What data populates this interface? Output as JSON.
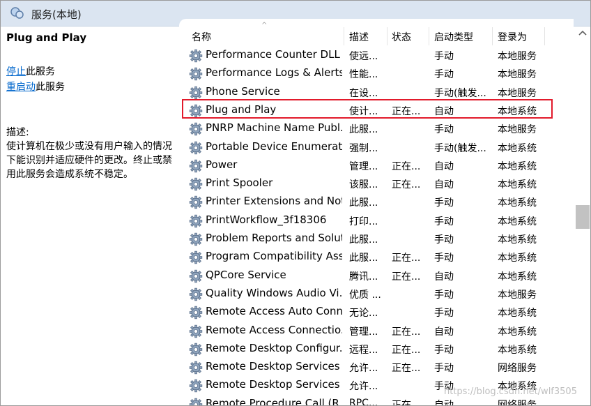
{
  "window": {
    "title": "服务(本地)"
  },
  "left_pane": {
    "service_title": "Plug and Play",
    "actions": [
      {
        "link": "停止",
        "text": "此服务"
      },
      {
        "link": "重启动",
        "text": "此服务"
      }
    ],
    "description_label": "描述:",
    "description": "使计算机在极少或没有用户输入的情况下能识别并适应硬件的更改。终止或禁用此服务会造成系统不稳定。"
  },
  "columns": {
    "name": "名称",
    "description": "描述",
    "status": "状态",
    "startup": "启动类型",
    "logon": "登录为"
  },
  "rows": [
    {
      "name": "Performance Counter DLL ...",
      "desc": "使远...",
      "status": "",
      "startup": "手动",
      "logon": "本地服务"
    },
    {
      "name": "Performance Logs & Alerts",
      "desc": "性能...",
      "status": "",
      "startup": "手动",
      "logon": "本地服务"
    },
    {
      "name": "Phone Service",
      "desc": "在设...",
      "status": "",
      "startup": "手动(触发...",
      "logon": "本地服务"
    },
    {
      "name": "Plug and Play",
      "desc": "使计...",
      "status": "正在...",
      "startup": "自动",
      "logon": "本地系统"
    },
    {
      "name": "PNRP Machine Name Publ...",
      "desc": "此服...",
      "status": "",
      "startup": "手动",
      "logon": "本地服务"
    },
    {
      "name": "Portable Device Enumerat...",
      "desc": "强制...",
      "status": "",
      "startup": "手动(触发...",
      "logon": "本地系统"
    },
    {
      "name": "Power",
      "desc": "管理...",
      "status": "正在...",
      "startup": "自动",
      "logon": "本地系统"
    },
    {
      "name": "Print Spooler",
      "desc": "该服...",
      "status": "正在...",
      "startup": "自动",
      "logon": "本地系统"
    },
    {
      "name": "Printer Extensions and Noti...",
      "desc": "此服...",
      "status": "",
      "startup": "手动",
      "logon": "本地系统"
    },
    {
      "name": "PrintWorkflow_3f18306",
      "desc": "打印...",
      "status": "",
      "startup": "手动",
      "logon": "本地系统"
    },
    {
      "name": "Problem Reports and Solut...",
      "desc": "此服...",
      "status": "",
      "startup": "手动",
      "logon": "本地系统"
    },
    {
      "name": "Program Compatibility Assi...",
      "desc": "此服...",
      "status": "正在...",
      "startup": "手动",
      "logon": "本地系统"
    },
    {
      "name": "QPCore Service",
      "desc": "腾讯...",
      "status": "正在...",
      "startup": "自动",
      "logon": "本地系统"
    },
    {
      "name": "Quality Windows Audio Vi...",
      "desc": "优质 ...",
      "status": "",
      "startup": "手动",
      "logon": "本地服务"
    },
    {
      "name": "Remote Access Auto Conn...",
      "desc": "无论...",
      "status": "",
      "startup": "手动",
      "logon": "本地系统"
    },
    {
      "name": "Remote Access Connectio...",
      "desc": "管理...",
      "status": "正在...",
      "startup": "自动",
      "logon": "本地系统"
    },
    {
      "name": "Remote Desktop Configur...",
      "desc": "远程...",
      "status": "正在...",
      "startup": "手动",
      "logon": "本地系统"
    },
    {
      "name": "Remote Desktop Services",
      "desc": "允许...",
      "status": "正在...",
      "startup": "手动",
      "logon": "网络服务"
    },
    {
      "name": "Remote Desktop Services ...",
      "desc": "允许...",
      "status": "",
      "startup": "手动",
      "logon": "本地系统"
    },
    {
      "name": "Remote Procedure Call (R...",
      "desc": "RPC...",
      "status": "正在...",
      "startup": "自动",
      "logon": "网络服务"
    }
  ],
  "watermark": "https://blog.csdn.net/wlf3505",
  "colors": {
    "highlight": "#e21a2b",
    "link": "#0066cc",
    "titlebar": "#dbe5f1"
  }
}
